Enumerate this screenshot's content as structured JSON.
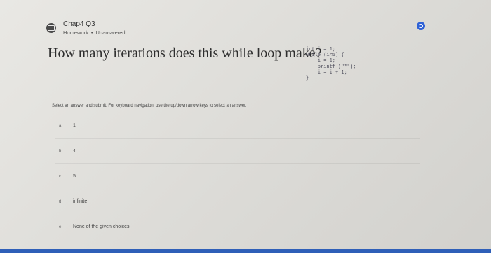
{
  "header": {
    "title": "Chap4 Q3",
    "type": "Homework",
    "status": "Unanswered"
  },
  "question": {
    "text": "How many iterations does this while loop make?",
    "code": "int i = 1;\nwhile (i<5) {\n    i = 1;\n    printf (\"*\");\n    i = i + 1;\n}"
  },
  "instructions": "Select an answer and submit. For keyboard navigation, use the up/down arrow keys to select an answer.",
  "choices": [
    {
      "letter": "a",
      "value": "1"
    },
    {
      "letter": "b",
      "value": "4"
    },
    {
      "letter": "c",
      "value": "5"
    },
    {
      "letter": "d",
      "value": "infinite"
    },
    {
      "letter": "e",
      "value": "None of the given choices"
    }
  ],
  "colors": {
    "accent": "#2f62d6",
    "bottom_bar": "#2f5fb8"
  }
}
